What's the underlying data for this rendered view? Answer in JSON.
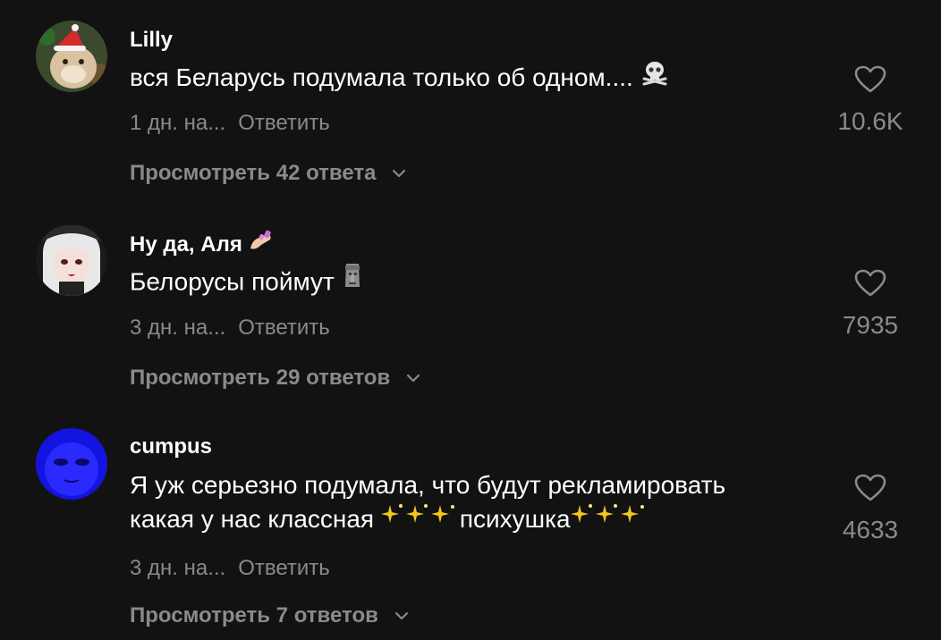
{
  "comments": [
    {
      "username": "Lilly",
      "text": "вся Беларусь подумала только об одном....",
      "text_emoji": "skull-crossbones",
      "time": "1 дн. на...",
      "reply_label": "Ответить",
      "likes": "10.6K",
      "view_replies": "Просмотреть 42 ответа",
      "avatar_icon": "cat-santa-hat"
    },
    {
      "username": "Ну да, Аля",
      "username_emoji": "nail-polish",
      "text": "Белорусы поймут",
      "text_emoji": "moai",
      "time": "3 дн. на...",
      "reply_label": "Ответить",
      "likes": "7935",
      "view_replies": "Просмотреть 29 ответов",
      "avatar_icon": "anime-girl"
    },
    {
      "username": "cumpus",
      "text_line1": "Я уж серьезно подумала, что будут рекламировать",
      "text_line2_a": "какая у нас классная ",
      "text_line2_b": "психушка",
      "text_emoji": "sparkles",
      "time": "3 дн. на...",
      "reply_label": "Ответить",
      "likes": "4633",
      "view_replies": "Просмотреть 7 ответов",
      "avatar_icon": "blue-face"
    }
  ],
  "colors": {
    "background": "#121212",
    "primary_text": "#ffffff",
    "secondary_text": "#8a8a8a"
  }
}
